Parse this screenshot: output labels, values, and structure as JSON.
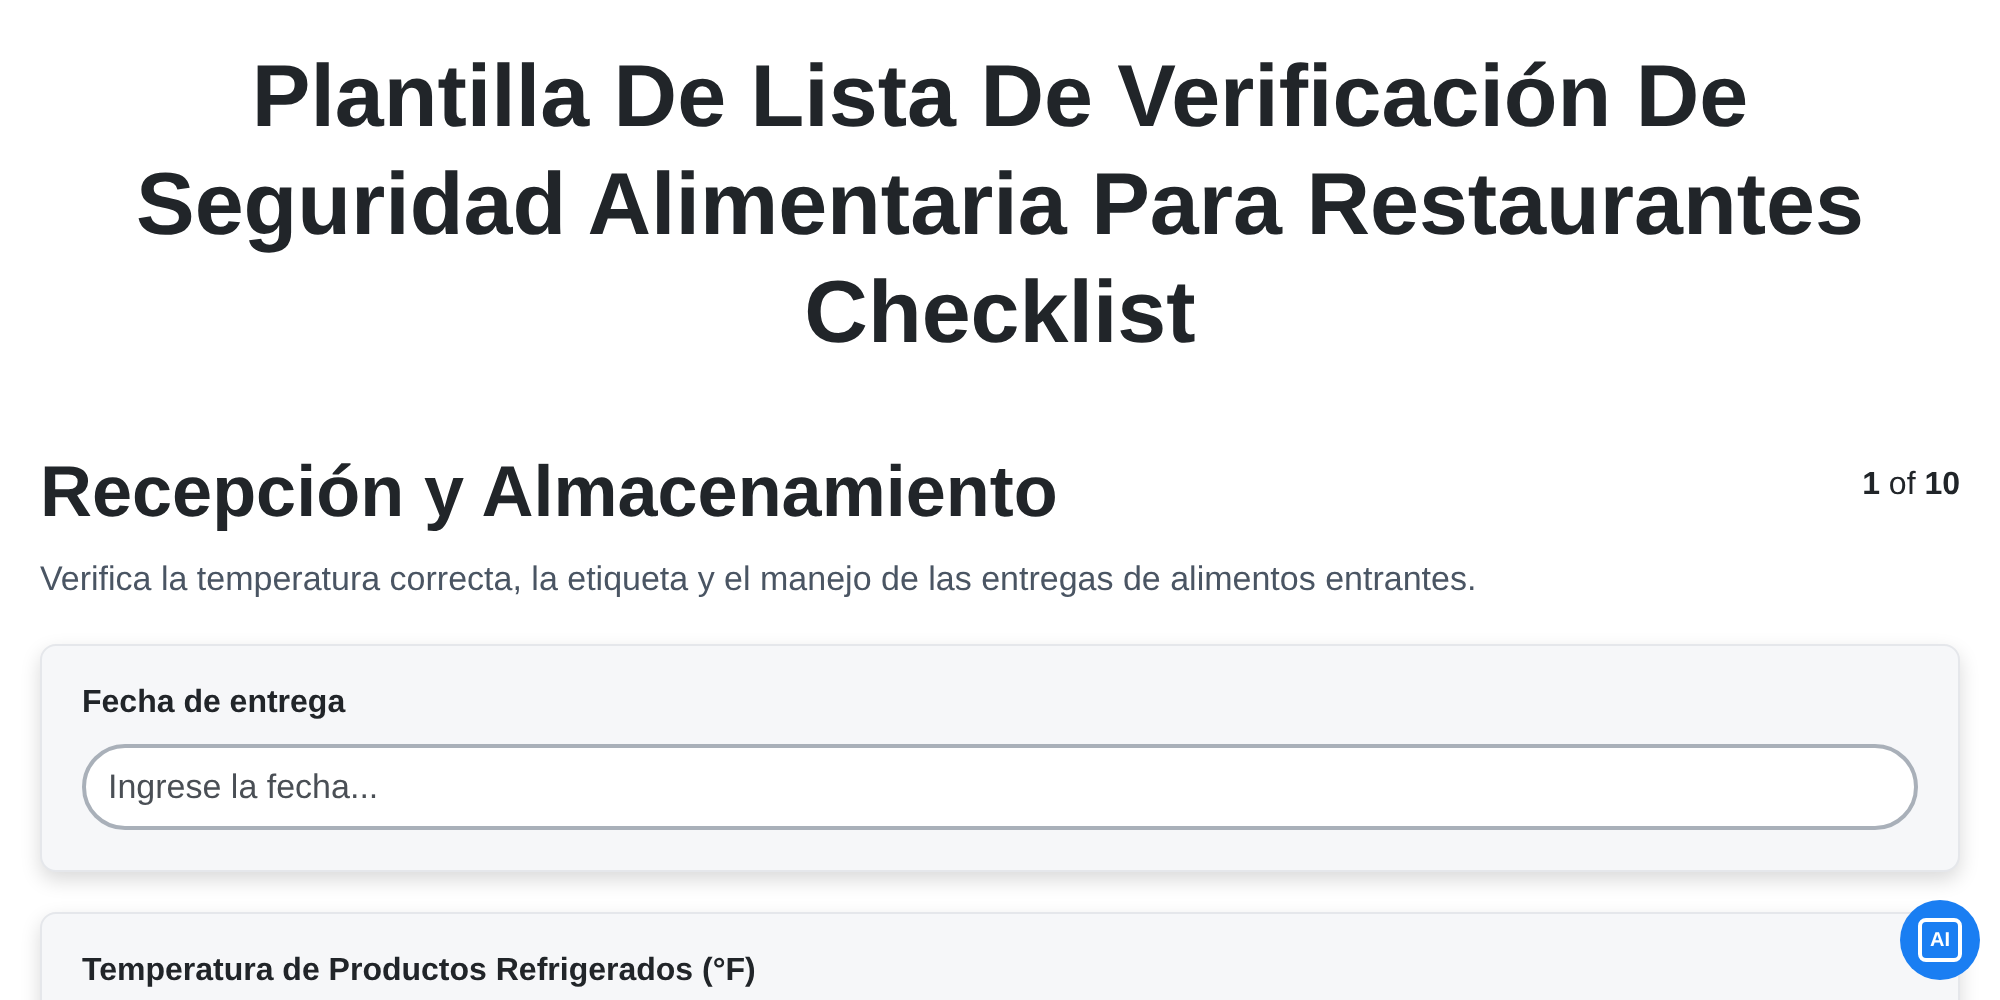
{
  "title": "Plantilla De Lista De Verificación De Seguridad Alimentaria Para Restaurantes Checklist",
  "section": {
    "heading": "Recepción y Almacenamiento",
    "counter": "**1** of **10**",
    "description": "Verifica la temperatura correcta, la etiqueta y el manejo de las entregas de alimentos entrantes."
  },
  "fields": [
    {
      "label": "Fecha de entrega",
      "placeholder": "Ingrese la fecha..."
    },
    {
      "label": "Temperatura de Productos Refrigerados (°F)"
    }
  ],
  "ai_button": {
    "label": "AI"
  }
}
